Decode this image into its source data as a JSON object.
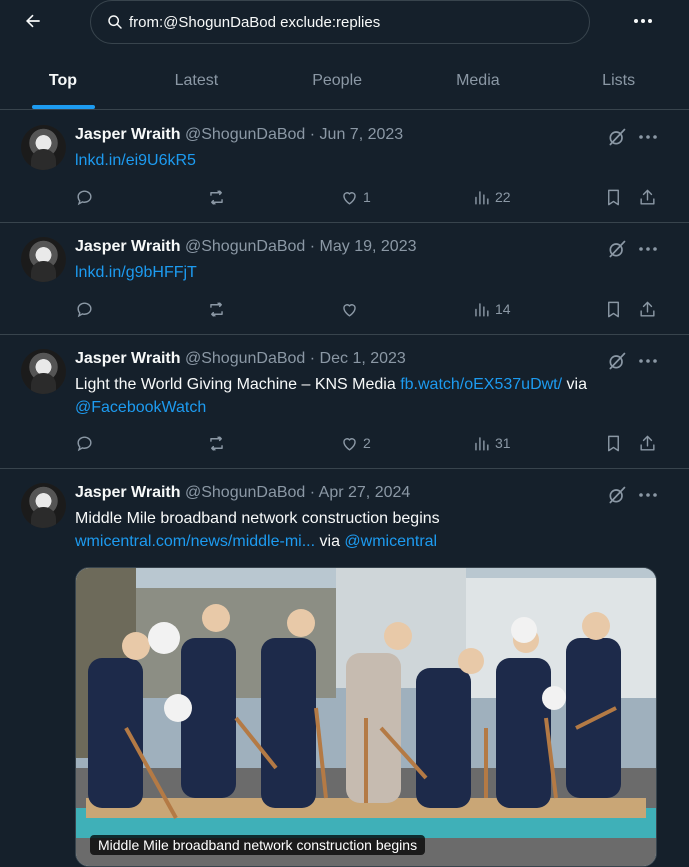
{
  "search": {
    "value": "from:@ShogunDaBod exclude:replies"
  },
  "tabs": [
    {
      "label": "Top"
    },
    {
      "label": "Latest"
    },
    {
      "label": "People"
    },
    {
      "label": "Media"
    },
    {
      "label": "Lists"
    }
  ],
  "tweets": [
    {
      "name": "Jasper Wraith",
      "handle": "@ShogunDaBod",
      "sep": "·",
      "date": "Jun 7, 2023",
      "link": "lnkd.in/ei9U6kR5",
      "likes": "1",
      "views": "22"
    },
    {
      "name": "Jasper Wraith",
      "handle": "@ShogunDaBod",
      "sep": "·",
      "date": "May 19, 2023",
      "link": "lnkd.in/g9bHFFjT",
      "likes": "",
      "views": "14"
    },
    {
      "name": "Jasper Wraith",
      "handle": "@ShogunDaBod",
      "sep": "·",
      "date": "Dec 1, 2023",
      "text": "Light the World Giving Machine – KNS Media ",
      "link": "fb.watch/oEX537uDwt/",
      "via": " via ",
      "mention": "@FacebookWatch",
      "likes": "2",
      "views": "31"
    },
    {
      "name": "Jasper Wraith",
      "handle": "@ShogunDaBod",
      "sep": "·",
      "date": "Apr 27, 2024",
      "text": "Middle Mile broadband network construction begins",
      "link": "wmicentral.com/news/middle-mi...",
      "via": " via ",
      "mention": "@wmicentral",
      "media_caption": "Middle Mile broadband network construction begins"
    }
  ],
  "colors": {
    "background": "#15202b",
    "accent": "#1d9bf0",
    "muted": "#8b98a5",
    "border": "#38444d"
  }
}
